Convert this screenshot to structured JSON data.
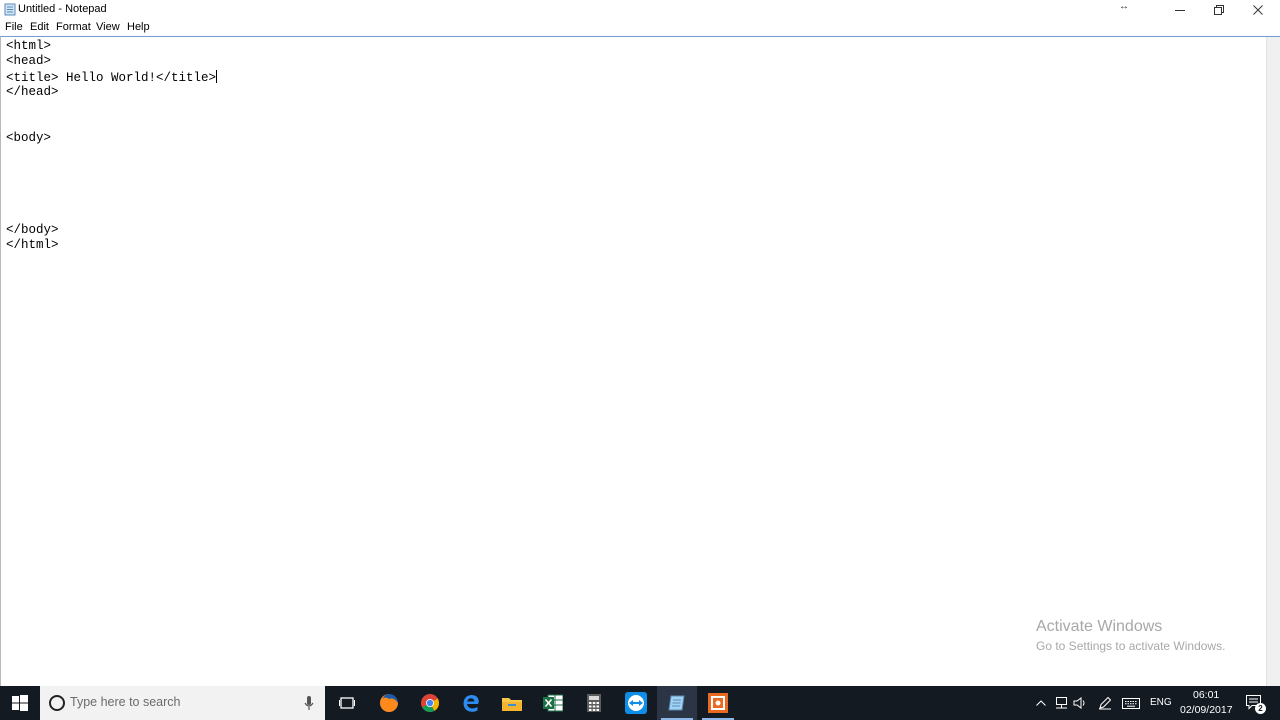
{
  "window": {
    "title": "Untitled - Notepad",
    "resize_glyph": "↔"
  },
  "menu": {
    "file": "File",
    "edit": "Edit",
    "format": "Format",
    "view": "View",
    "help": "Help"
  },
  "editor": {
    "lines": [
      "<html>",
      "<head>",
      "<title> Hello World!</title>",
      "</head>",
      "",
      "",
      "<body>",
      "",
      "",
      "",
      "",
      "",
      "</body>",
      "</html>"
    ],
    "caret_line": 2
  },
  "watermark": {
    "title": "Activate Windows",
    "subtitle": "Go to Settings to activate Windows."
  },
  "taskbar": {
    "search_placeholder": "Type here to search",
    "apps": [
      "firefox-icon",
      "chrome-icon",
      "edge-icon",
      "file-explorer-icon",
      "excel-icon",
      "calculator-icon",
      "teamviewer-icon",
      "notepad-icon",
      "presentation-app-icon"
    ],
    "language": "ENG",
    "time": "06:01",
    "date": "02/09/2017",
    "notification_count": "2"
  },
  "colors": {
    "taskbar_bg": "#141a22",
    "editor_border": "#7a9ccc",
    "watermark": "#a8a8a8"
  }
}
